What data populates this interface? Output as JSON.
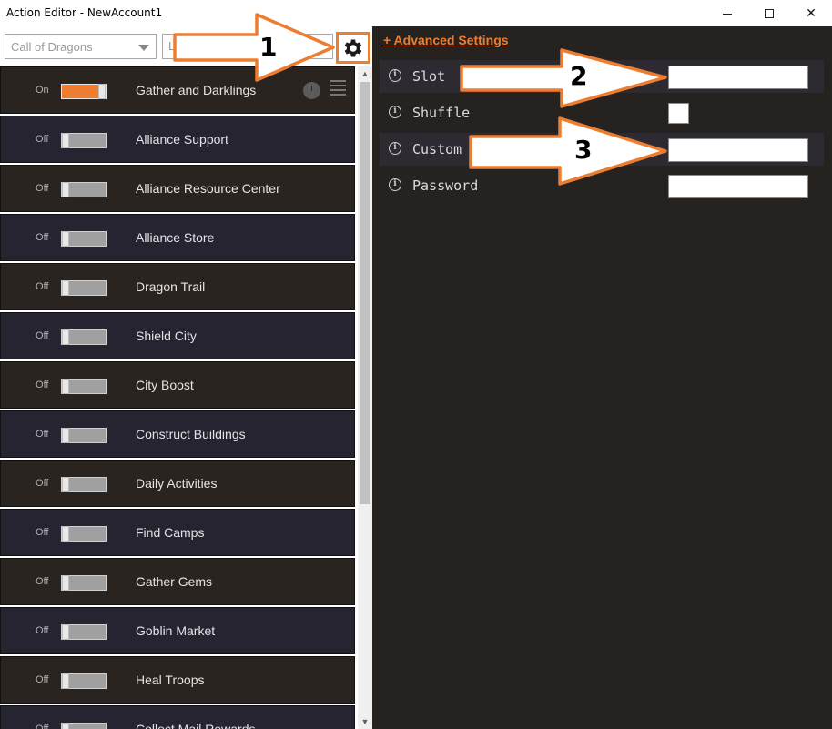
{
  "window": {
    "title": "Action Editor - NewAccount1",
    "minimize_glyph": "",
    "maximize_glyph": "",
    "close_glyph": "✕"
  },
  "toolbar": {
    "game_select_value": "Call of Dragons",
    "second_select_value": "L",
    "settings_icon": "gear-icon"
  },
  "actions": [
    {
      "state": "On",
      "name": "Gather and Darklings",
      "enabled": true
    },
    {
      "state": "Off",
      "name": "Alliance Support",
      "enabled": false
    },
    {
      "state": "Off",
      "name": "Alliance Resource Center",
      "enabled": false
    },
    {
      "state": "Off",
      "name": "Alliance Store",
      "enabled": false
    },
    {
      "state": "Off",
      "name": "Dragon Trail",
      "enabled": false
    },
    {
      "state": "Off",
      "name": "Shield City",
      "enabled": false
    },
    {
      "state": "Off",
      "name": "City Boost",
      "enabled": false
    },
    {
      "state": "Off",
      "name": "Construct Buildings",
      "enabled": false
    },
    {
      "state": "Off",
      "name": "Daily Activities",
      "enabled": false
    },
    {
      "state": "Off",
      "name": "Find Camps",
      "enabled": false
    },
    {
      "state": "Off",
      "name": "Gather Gems",
      "enabled": false
    },
    {
      "state": "Off",
      "name": "Goblin Market",
      "enabled": false
    },
    {
      "state": "Off",
      "name": "Heal Troops",
      "enabled": false
    },
    {
      "state": "Off",
      "name": "Collect Mail Rewards",
      "enabled": false
    }
  ],
  "settings": {
    "advanced_link": "+ Advanced Settings",
    "rows": [
      {
        "label": "Slot",
        "type": "text",
        "value": ""
      },
      {
        "label": "Shuffle",
        "type": "checkbox",
        "value": ""
      },
      {
        "label": "Custom",
        "type": "text",
        "value": ""
      },
      {
        "label": "Password",
        "type": "text",
        "value": ""
      }
    ]
  },
  "callouts": [
    "1",
    "2",
    "3"
  ],
  "colors": {
    "accent": "#ed7d31",
    "panel_dark": "#262220",
    "row_dark": "#252430",
    "row_brown": "#2a2421"
  }
}
